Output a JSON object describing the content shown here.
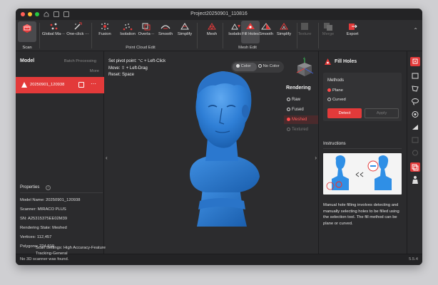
{
  "window": {
    "title": "Project20250901_110816"
  },
  "ribbon": {
    "scan": {
      "label": "Scan"
    },
    "point_cloud_tools": [
      {
        "label": "Global Ma···",
        "icon": "global-markers-icon"
      },
      {
        "label": "One-click ···",
        "icon": "one-click-edit-icon"
      },
      {
        "label": "Fusion",
        "icon": "fusion-icon"
      },
      {
        "label": "Isolation",
        "icon": "isolation-icon"
      },
      {
        "label": "Overla···",
        "icon": "overlap-icon"
      },
      {
        "label": "Smooth",
        "icon": "smooth-icon"
      },
      {
        "label": "Simplify",
        "icon": "simplify-icon"
      }
    ],
    "point_cloud_group_label": "Point Cloud Edit",
    "mesh_tools": [
      {
        "label": "Mesh",
        "icon": "mesh-icon"
      },
      {
        "label": "Isolation",
        "icon": "isolation-icon"
      },
      {
        "label": "Fill Holes",
        "icon": "fill-holes-icon"
      },
      {
        "label": "Smooth",
        "icon": "smooth-icon"
      },
      {
        "label": "Simplify",
        "icon": "simplify-icon"
      }
    ],
    "mesh_group_label": "Mesh Edit",
    "texture_label": "Texture",
    "merge_label": "Merge",
    "export_label": "Export"
  },
  "left_panel": {
    "title": "Model",
    "batch_label": "Batch Processing",
    "more_label": "More",
    "model_item": {
      "name": "20250901_120938"
    },
    "properties_title": "Properties",
    "properties": [
      "Model Name:  20250901_120938",
      "Scanner:  MIRACO PLUS",
      "SN:  A25315375EE02M39",
      "Rendering State:  Meshed",
      "Vertices:  112,457",
      "Polygons:  224,910",
      "Scan Settings:  High Accuracy-Feature",
      "Tracking-General"
    ]
  },
  "viewport": {
    "hints": [
      "Set pivot point: ⌥ + Left-Click",
      "Move: ⇧ + Left-Drag",
      "Reset: Space"
    ],
    "color_toggle": {
      "color": "Color",
      "no_color": "No Color"
    },
    "rendering": {
      "title": "Rendering",
      "options": [
        "Raw",
        "Fused",
        "Meshed",
        "Textured"
      ],
      "selected": "Meshed"
    },
    "mesh_color": "#2f7fd6"
  },
  "right_panel": {
    "title": "Fill Holes",
    "methods_title": "Methods",
    "method_options": [
      "Plane",
      "Curved"
    ],
    "method_selected": "Plane",
    "detect_label": "Detect",
    "apply_label": "Apply",
    "instructions_title": "Instructions",
    "instructions_text": "Manual hole filling involves detecting and manually selecting holes to be filled using the selection tool. The fill method can be plane or curved."
  },
  "status": {
    "message": "No 3D scanner was found.",
    "version": "5.5.4"
  },
  "colors": {
    "accent": "#e33a3a",
    "model": "#2f7fd6"
  }
}
